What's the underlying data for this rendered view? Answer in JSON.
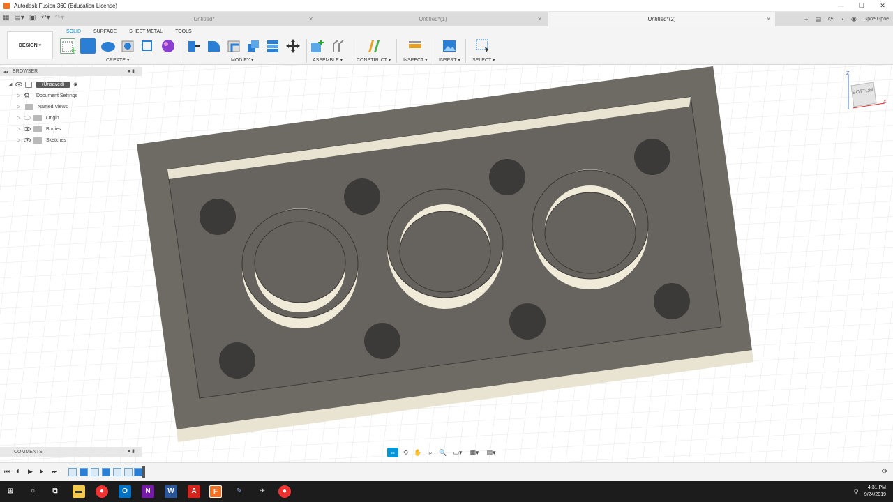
{
  "app": {
    "title": "Autodesk Fusion 360 (Education License)",
    "window_controls": [
      "—",
      "❐",
      "✕"
    ]
  },
  "tabs": [
    {
      "label": "Untitled*",
      "close": "✕"
    },
    {
      "label": "Untitled*(1)",
      "close": "✕"
    },
    {
      "label": "Untitled*(2)",
      "close": "✕"
    }
  ],
  "user": "Gpoe Gpoe",
  "toolbar": {
    "workspace": "DESIGN ▾",
    "ws_tabs": [
      "SOLID",
      "SURFACE",
      "SHEET METAL",
      "TOOLS"
    ],
    "groups": [
      "CREATE ▾",
      "MODIFY ▾",
      "ASSEMBLE ▾",
      "CONSTRUCT ▾",
      "INSPECT ▾",
      "INSERT ▾",
      "SELECT ▾"
    ]
  },
  "browser": {
    "header": "BROWSER",
    "root": "(Unsaved)",
    "items": [
      "Document Settings",
      "Named Views",
      "Origin",
      "Bodies",
      "Sketches"
    ]
  },
  "comments": {
    "header": "COMMENTS"
  },
  "viewcube": {
    "face": "BOTTOM",
    "axis_z": "Z",
    "axis_x": "X"
  },
  "clock": {
    "time": "4:31 PM",
    "date": "9/24/2019"
  },
  "colors": {
    "accent": "#0696d7",
    "body": "#6e6a64",
    "body_edge": "#e9e3d2"
  },
  "icons": {
    "taskbar": [
      "windows-icon",
      "search-icon",
      "task-view-icon",
      "file-explorer-icon",
      "chrome-icon",
      "outlook-icon",
      "onenote-icon",
      "word-icon",
      "acrobat-icon",
      "fusion-icon",
      "app-icon",
      "app-icon",
      "chrome-icon"
    ]
  }
}
